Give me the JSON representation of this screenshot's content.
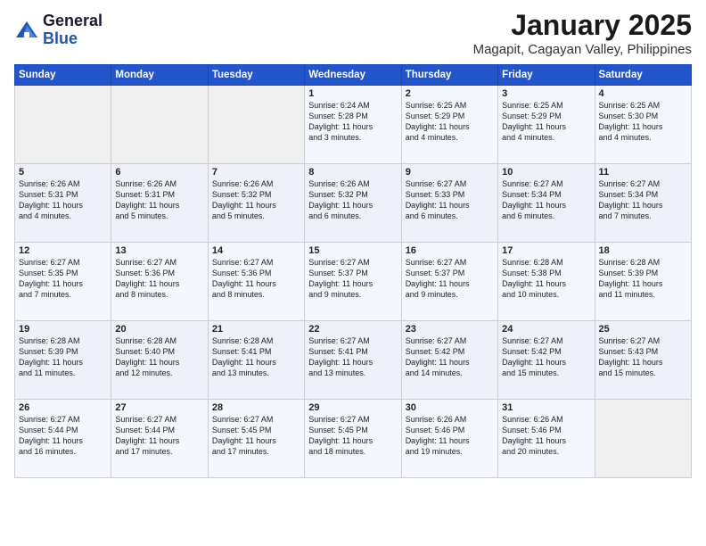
{
  "header": {
    "logo_general": "General",
    "logo_blue": "Blue",
    "title": "January 2025",
    "subtitle": "Magapit, Cagayan Valley, Philippines"
  },
  "weekdays": [
    "Sunday",
    "Monday",
    "Tuesday",
    "Wednesday",
    "Thursday",
    "Friday",
    "Saturday"
  ],
  "weeks": [
    [
      {
        "day": "",
        "content": ""
      },
      {
        "day": "",
        "content": ""
      },
      {
        "day": "",
        "content": ""
      },
      {
        "day": "1",
        "content": "Sunrise: 6:24 AM\nSunset: 5:28 PM\nDaylight: 11 hours\nand 3 minutes."
      },
      {
        "day": "2",
        "content": "Sunrise: 6:25 AM\nSunset: 5:29 PM\nDaylight: 11 hours\nand 4 minutes."
      },
      {
        "day": "3",
        "content": "Sunrise: 6:25 AM\nSunset: 5:29 PM\nDaylight: 11 hours\nand 4 minutes."
      },
      {
        "day": "4",
        "content": "Sunrise: 6:25 AM\nSunset: 5:30 PM\nDaylight: 11 hours\nand 4 minutes."
      }
    ],
    [
      {
        "day": "5",
        "content": "Sunrise: 6:26 AM\nSunset: 5:31 PM\nDaylight: 11 hours\nand 4 minutes."
      },
      {
        "day": "6",
        "content": "Sunrise: 6:26 AM\nSunset: 5:31 PM\nDaylight: 11 hours\nand 5 minutes."
      },
      {
        "day": "7",
        "content": "Sunrise: 6:26 AM\nSunset: 5:32 PM\nDaylight: 11 hours\nand 5 minutes."
      },
      {
        "day": "8",
        "content": "Sunrise: 6:26 AM\nSunset: 5:32 PM\nDaylight: 11 hours\nand 6 minutes."
      },
      {
        "day": "9",
        "content": "Sunrise: 6:27 AM\nSunset: 5:33 PM\nDaylight: 11 hours\nand 6 minutes."
      },
      {
        "day": "10",
        "content": "Sunrise: 6:27 AM\nSunset: 5:34 PM\nDaylight: 11 hours\nand 6 minutes."
      },
      {
        "day": "11",
        "content": "Sunrise: 6:27 AM\nSunset: 5:34 PM\nDaylight: 11 hours\nand 7 minutes."
      }
    ],
    [
      {
        "day": "12",
        "content": "Sunrise: 6:27 AM\nSunset: 5:35 PM\nDaylight: 11 hours\nand 7 minutes."
      },
      {
        "day": "13",
        "content": "Sunrise: 6:27 AM\nSunset: 5:36 PM\nDaylight: 11 hours\nand 8 minutes."
      },
      {
        "day": "14",
        "content": "Sunrise: 6:27 AM\nSunset: 5:36 PM\nDaylight: 11 hours\nand 8 minutes."
      },
      {
        "day": "15",
        "content": "Sunrise: 6:27 AM\nSunset: 5:37 PM\nDaylight: 11 hours\nand 9 minutes."
      },
      {
        "day": "16",
        "content": "Sunrise: 6:27 AM\nSunset: 5:37 PM\nDaylight: 11 hours\nand 9 minutes."
      },
      {
        "day": "17",
        "content": "Sunrise: 6:28 AM\nSunset: 5:38 PM\nDaylight: 11 hours\nand 10 minutes."
      },
      {
        "day": "18",
        "content": "Sunrise: 6:28 AM\nSunset: 5:39 PM\nDaylight: 11 hours\nand 11 minutes."
      }
    ],
    [
      {
        "day": "19",
        "content": "Sunrise: 6:28 AM\nSunset: 5:39 PM\nDaylight: 11 hours\nand 11 minutes."
      },
      {
        "day": "20",
        "content": "Sunrise: 6:28 AM\nSunset: 5:40 PM\nDaylight: 11 hours\nand 12 minutes."
      },
      {
        "day": "21",
        "content": "Sunrise: 6:28 AM\nSunset: 5:41 PM\nDaylight: 11 hours\nand 13 minutes."
      },
      {
        "day": "22",
        "content": "Sunrise: 6:27 AM\nSunset: 5:41 PM\nDaylight: 11 hours\nand 13 minutes."
      },
      {
        "day": "23",
        "content": "Sunrise: 6:27 AM\nSunset: 5:42 PM\nDaylight: 11 hours\nand 14 minutes."
      },
      {
        "day": "24",
        "content": "Sunrise: 6:27 AM\nSunset: 5:42 PM\nDaylight: 11 hours\nand 15 minutes."
      },
      {
        "day": "25",
        "content": "Sunrise: 6:27 AM\nSunset: 5:43 PM\nDaylight: 11 hours\nand 15 minutes."
      }
    ],
    [
      {
        "day": "26",
        "content": "Sunrise: 6:27 AM\nSunset: 5:44 PM\nDaylight: 11 hours\nand 16 minutes."
      },
      {
        "day": "27",
        "content": "Sunrise: 6:27 AM\nSunset: 5:44 PM\nDaylight: 11 hours\nand 17 minutes."
      },
      {
        "day": "28",
        "content": "Sunrise: 6:27 AM\nSunset: 5:45 PM\nDaylight: 11 hours\nand 17 minutes."
      },
      {
        "day": "29",
        "content": "Sunrise: 6:27 AM\nSunset: 5:45 PM\nDaylight: 11 hours\nand 18 minutes."
      },
      {
        "day": "30",
        "content": "Sunrise: 6:26 AM\nSunset: 5:46 PM\nDaylight: 11 hours\nand 19 minutes."
      },
      {
        "day": "31",
        "content": "Sunrise: 6:26 AM\nSunset: 5:46 PM\nDaylight: 11 hours\nand 20 minutes."
      },
      {
        "day": "",
        "content": ""
      }
    ]
  ]
}
